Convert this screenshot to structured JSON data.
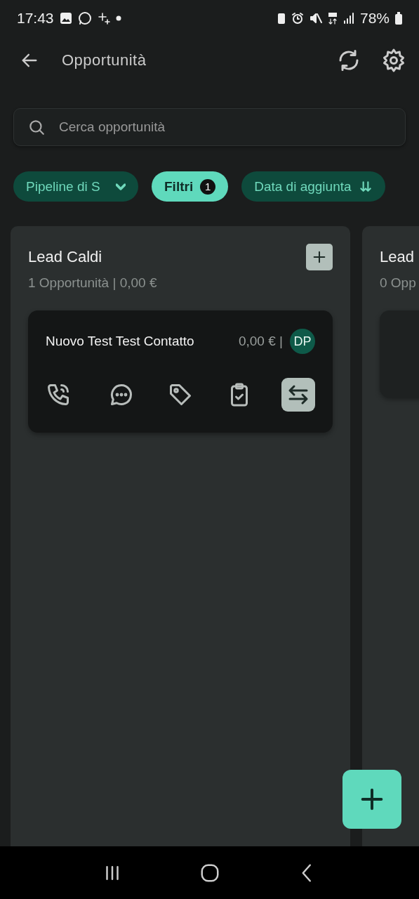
{
  "status_bar": {
    "time": "17:43",
    "battery": "78%"
  },
  "app_bar": {
    "title": "Opportunità"
  },
  "search": {
    "placeholder": "Cerca opportunità"
  },
  "chips": [
    {
      "kind": "dropdown",
      "label": "Pipeline di S",
      "selected": false
    },
    {
      "kind": "filter",
      "label": "Filtri",
      "badge": "1",
      "selected": true
    },
    {
      "kind": "sort",
      "label": "Data di aggiunta",
      "selected": false
    }
  ],
  "columns": [
    {
      "title": "Lead Caldi",
      "summary": "1 Opportunità | 0,00 €",
      "cards": [
        {
          "name": "Nuovo Test Test Contatto",
          "value": "0,00 € |",
          "avatar": "DP",
          "actions": [
            {
              "kind": "call",
              "selected": false
            },
            {
              "kind": "message",
              "selected": false
            },
            {
              "kind": "tag",
              "selected": false
            },
            {
              "kind": "task",
              "selected": false
            },
            {
              "kind": "move",
              "selected": true
            }
          ]
        }
      ]
    },
    {
      "title": "Lead",
      "summary": "0 Opp",
      "cards": [
        {
          "kind": "blank"
        }
      ]
    }
  ]
}
